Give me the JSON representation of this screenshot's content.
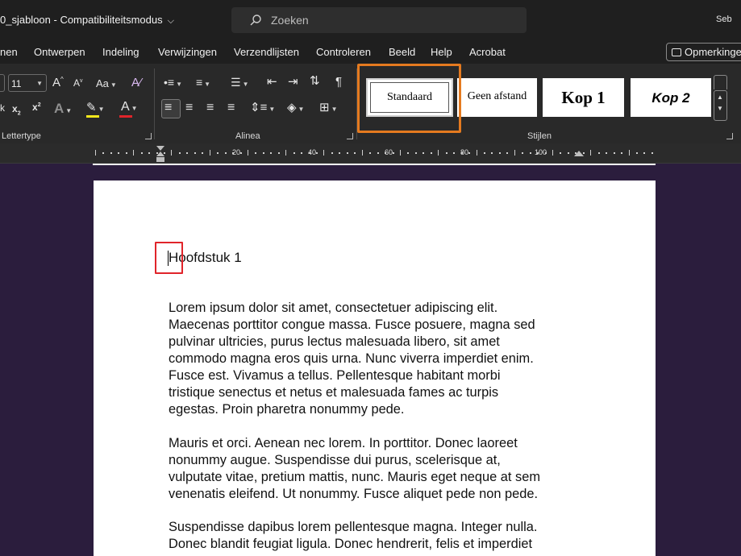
{
  "window": {
    "title": "0_sjabloon  -  Compatibiliteitsmodus",
    "search_placeholder": "Zoeken",
    "user": "Seb"
  },
  "tabs": [
    "nen",
    "Ontwerpen",
    "Indeling",
    "Verwijzingen",
    "Verzendlijsten",
    "Controleren",
    "Beeld",
    "Help",
    "Acrobat"
  ],
  "comments_label": "Opmerkinge",
  "ribbon": {
    "font_size": "11",
    "groups": {
      "font": "Lettertype",
      "paragraph": "Alinea",
      "styles": "Stijlen"
    },
    "styles": {
      "standaard": "Standaard",
      "geen_afstand": "Geen afstand",
      "kop1": "Kop 1",
      "kop2": "Kop 2"
    },
    "colors": {
      "highlight": "#f5e81c",
      "font_color": "#e0242a"
    }
  },
  "ruler": {
    "labels": [
      "20",
      "40",
      "60",
      "80",
      "100"
    ]
  },
  "document": {
    "heading": "Hoofdstuk 1",
    "paragraphs": [
      [
        "Lorem ipsum dolor sit amet, consectetuer adipiscing elit.",
        "Maecenas porttitor congue massa. Fusce posuere, magna sed",
        "pulvinar ultricies, purus lectus malesuada libero, sit amet",
        "commodo magna eros quis urna. Nunc viverra imperdiet enim.",
        "Fusce est. Vivamus a tellus. Pellentesque habitant morbi",
        "tristique senectus et netus et malesuada fames ac turpis",
        "egestas. Proin pharetra nonummy pede."
      ],
      [
        "Mauris et orci. Aenean nec lorem. In porttitor. Donec laoreet",
        "nonummy augue. Suspendisse dui purus, scelerisque at,",
        "vulputate vitae, pretium mattis, nunc. Mauris eget neque at sem",
        "venenatis eleifend. Ut nonummy. Fusce aliquet pede non pede."
      ],
      [
        "Suspendisse dapibus lorem pellentesque magna. Integer nulla.",
        "Donec blandit feugiat ligula. Donec hendrerit, felis et imperdiet"
      ]
    ]
  }
}
